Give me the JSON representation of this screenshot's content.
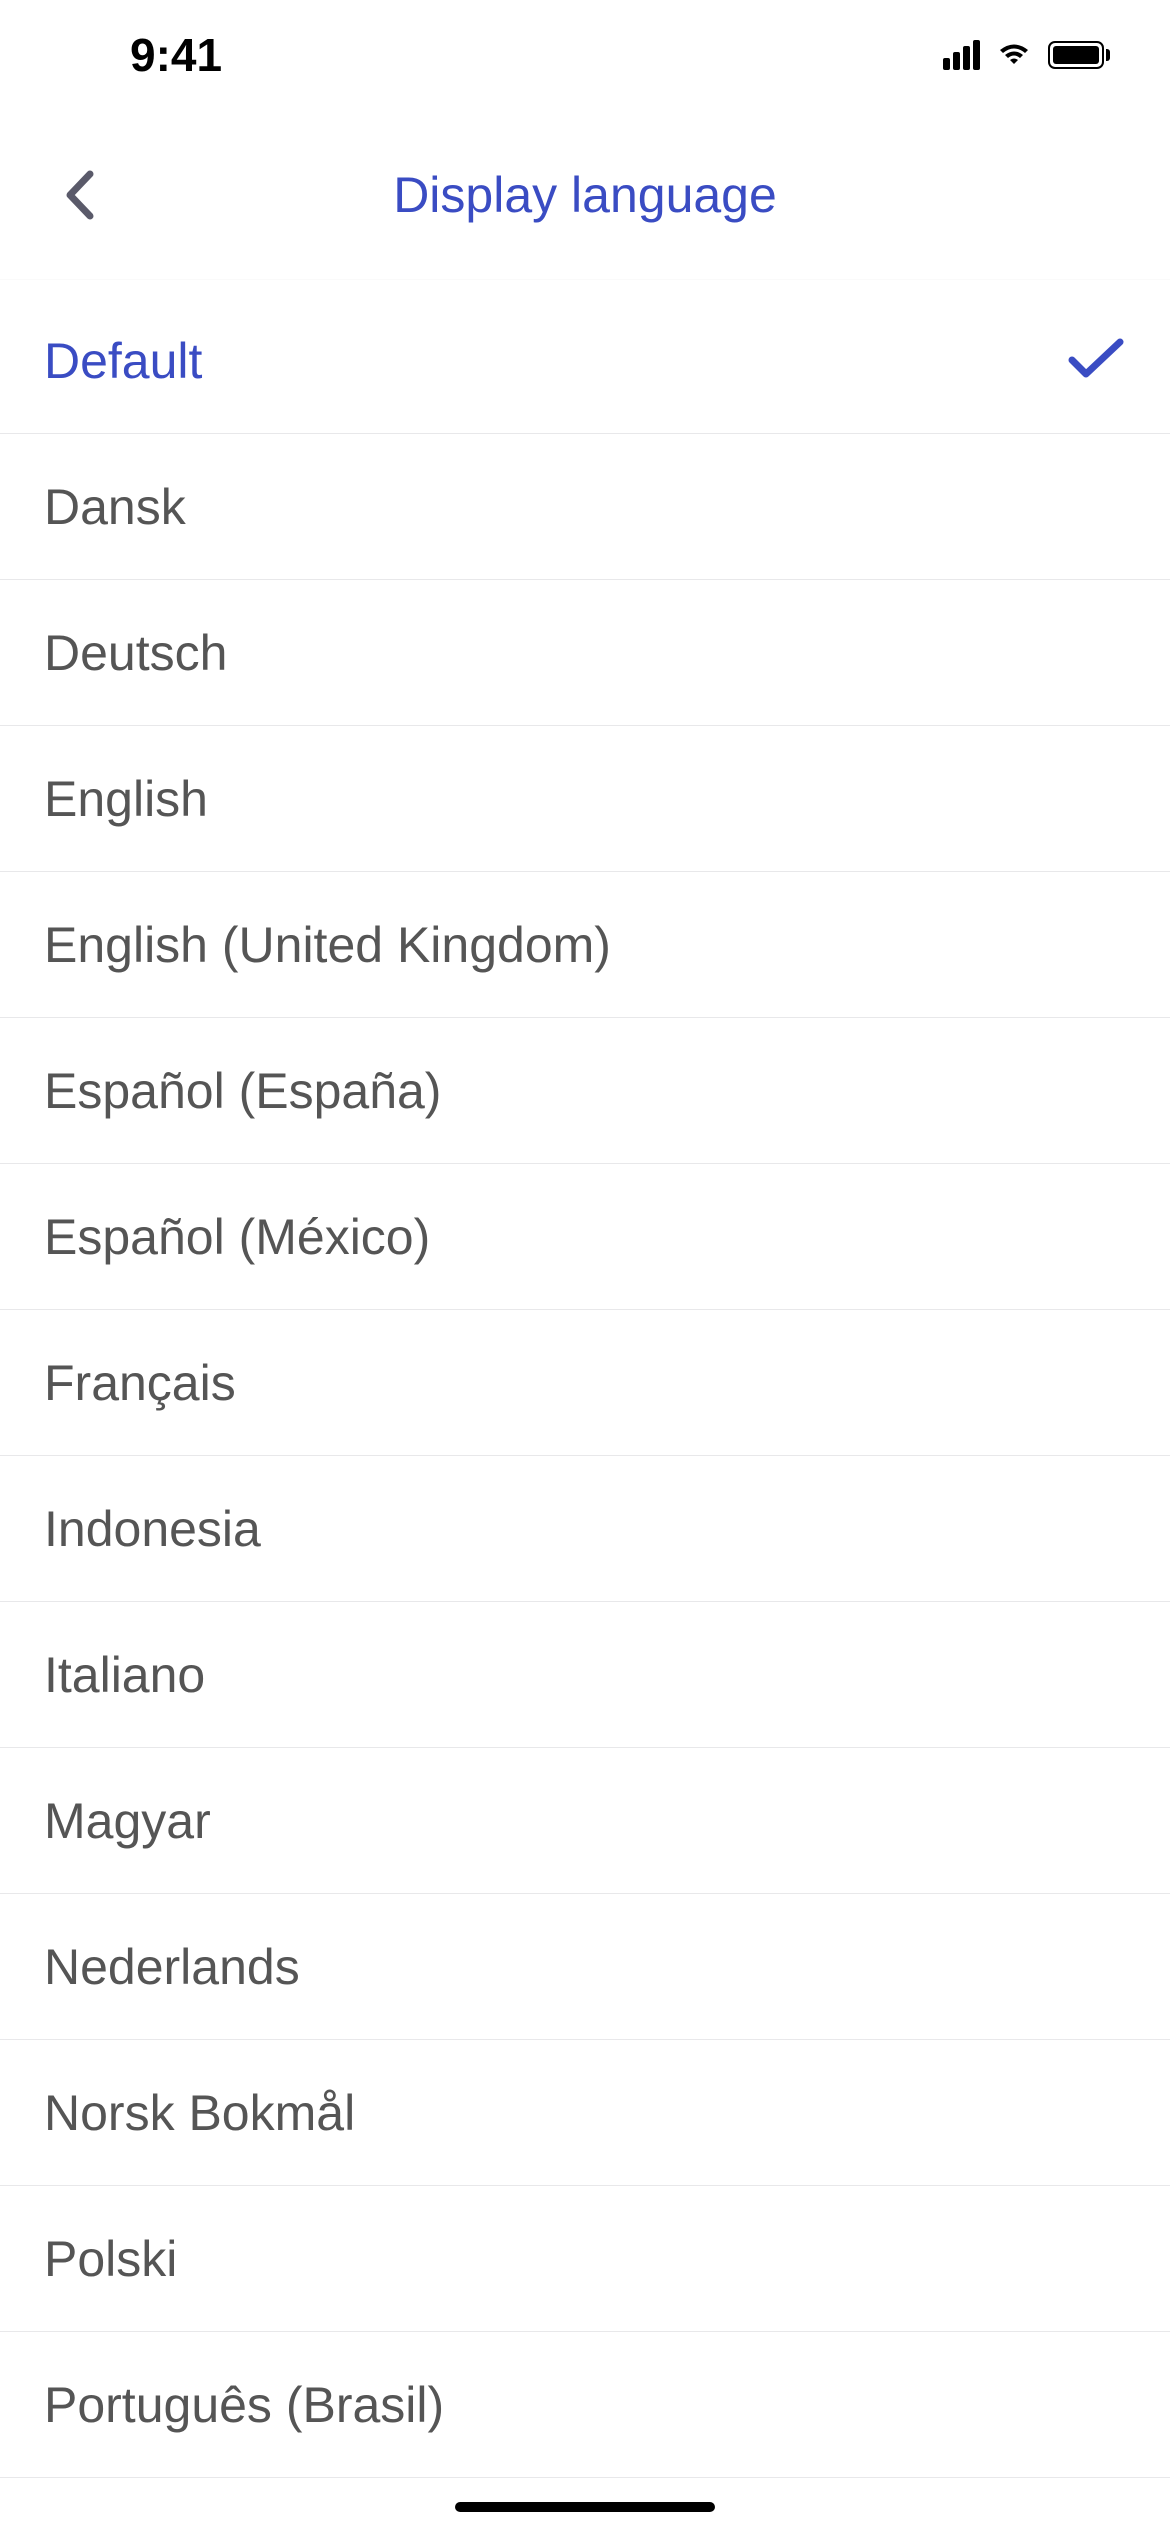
{
  "statusBar": {
    "time": "9:41"
  },
  "navBar": {
    "title": "Display language"
  },
  "languages": [
    {
      "label": "Default",
      "selected": true
    },
    {
      "label": "Dansk",
      "selected": false
    },
    {
      "label": "Deutsch",
      "selected": false
    },
    {
      "label": "English",
      "selected": false
    },
    {
      "label": "English (United Kingdom)",
      "selected": false
    },
    {
      "label": "Español (España)",
      "selected": false
    },
    {
      "label": "Español (México)",
      "selected": false
    },
    {
      "label": "Français",
      "selected": false
    },
    {
      "label": "Indonesia",
      "selected": false
    },
    {
      "label": "Italiano",
      "selected": false
    },
    {
      "label": "Magyar",
      "selected": false
    },
    {
      "label": "Nederlands",
      "selected": false
    },
    {
      "label": "Norsk Bokmål",
      "selected": false
    },
    {
      "label": "Polski",
      "selected": false
    },
    {
      "label": "Português (Brasil)",
      "selected": false
    }
  ],
  "colors": {
    "accent": "#3a4cc3",
    "textPrimary": "#555",
    "separator": "#e8e8ea"
  }
}
